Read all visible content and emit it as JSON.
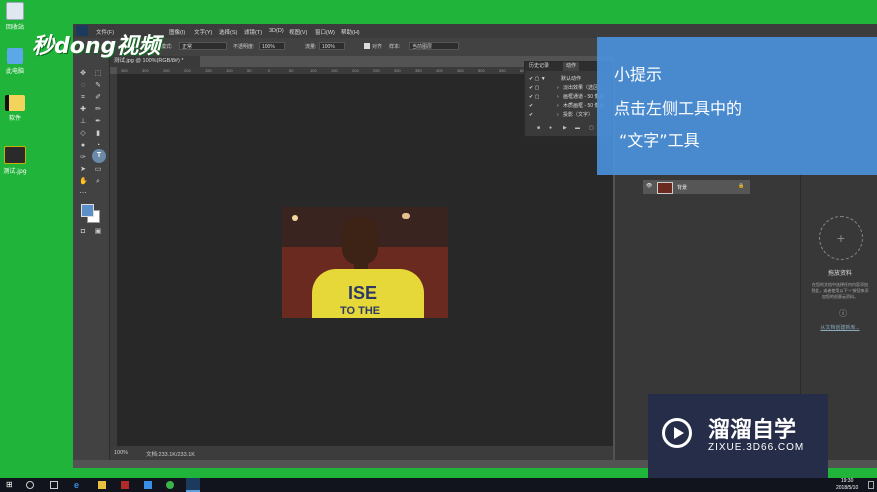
{
  "desktop": {
    "icons": [
      {
        "label": "回收站",
        "icon": "recycle-bin-icon"
      },
      {
        "label": "此电脑",
        "icon": "computer-icon"
      },
      {
        "label": "软件",
        "icon": "folder-icon"
      },
      {
        "label": "测试.jpg",
        "icon": "image-file-icon"
      }
    ],
    "logo_text": "秒dong视频"
  },
  "menubar": {
    "items": [
      "文件(F)",
      "编辑(E)",
      "图像(I)",
      "文字(Y)",
      "选择(S)",
      "滤镜(T)",
      "3D(D)",
      "视图(V)",
      "窗口(W)",
      "帮助(H)"
    ]
  },
  "options_bar": {
    "mode_label": "模式:",
    "mode_value": "正常",
    "opacity_label": "不透明度:",
    "opacity_value": "100%",
    "flow_label": "流量:",
    "flow_value": "100%",
    "align_label": "对齐",
    "sample_label": "样本:",
    "sample_value": "当前图层"
  },
  "document": {
    "tab_title": "测试.jpg @ 100%(RGB/8#) *",
    "zoom": "100%",
    "doc_size": "文档:233.1K/233.1K",
    "ruler_ticks": [
      "350",
      "300",
      "250",
      "200",
      "150",
      "100",
      "50",
      "0",
      "50",
      "100",
      "150",
      "200",
      "250",
      "300",
      "350",
      "400",
      "450",
      "500",
      "550",
      "600",
      "650",
      "700",
      "750"
    ]
  },
  "photo": {
    "shirt_text_line1": "ISE",
    "shirt_text_line2": "TO THE"
  },
  "actions_panel": {
    "tabs": [
      "历史记录",
      "动作"
    ],
    "rows": [
      "默认动作",
      "淡出效果（选区）",
      "画框通道 - 50 像素",
      "木质画框 - 50 像素",
      "投影（文字）"
    ]
  },
  "layers_panel": {
    "layer_name": "背景"
  },
  "libraries_panel": {
    "title": "拖放资料",
    "desc_line1": "在您的文档中选择任何内容添加",
    "desc_line2": "到此，或者使用以下\"+\"按钮来添",
    "desc_line3": "加您的创意云资料。",
    "link": "从文档创建新库..."
  },
  "tip": {
    "line1": "小提示",
    "line2": "点击左侧工具中的",
    "line3": "“文字”工具"
  },
  "watermark": {
    "brand": "溜溜自学",
    "url": "ZIXUE.3D66.COM"
  },
  "taskbar": {
    "time": "19:30",
    "date": "2018/5/10"
  },
  "colors": {
    "desktop_green": "#21b43a",
    "tip_blue": "#4a90d9",
    "watermark_bg": "#262d49"
  }
}
